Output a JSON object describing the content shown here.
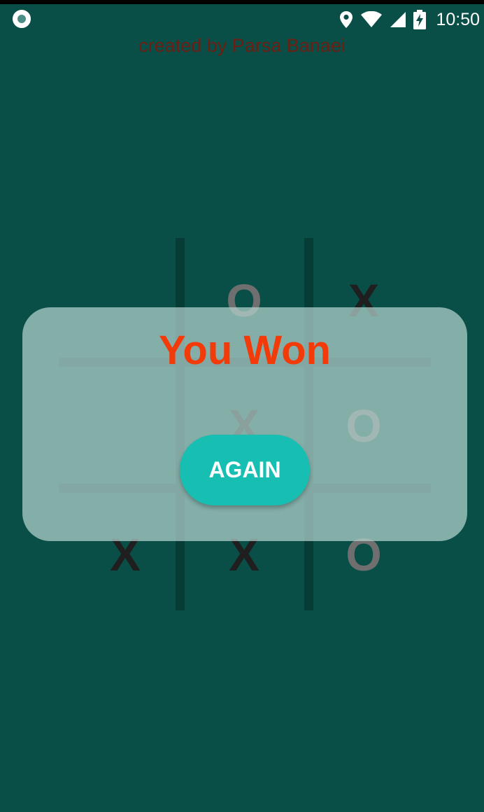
{
  "status_bar": {
    "time": "10:50",
    "left_icon": "record-icon",
    "icons": [
      "location-icon",
      "wifi-icon",
      "signal-icon",
      "battery-charging-icon"
    ]
  },
  "credit_text": "created by Parsa Banaei",
  "board": {
    "cells": [
      "",
      "O",
      "X",
      "",
      "X",
      "O",
      "X",
      "X",
      "O"
    ]
  },
  "dialog": {
    "title": "You Won",
    "button_label": "AGAIN"
  },
  "colors": {
    "background": "#0a4f47",
    "grid_line": "#063c35",
    "title": "#f23b08",
    "button": "#16bfb1",
    "credit": "#6b1f14"
  }
}
